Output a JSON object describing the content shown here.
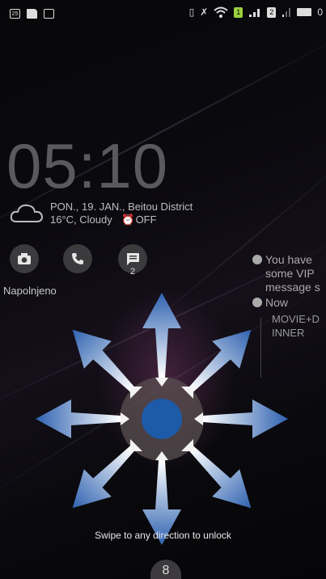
{
  "status_bar": {
    "left_icons": [
      "calendar-icon",
      "sim-card-icon",
      "image-icon"
    ],
    "right_icons": [
      "vibrate-icon",
      "no-alarm-icon",
      "wifi-icon",
      "sim1-signal-icon",
      "sim2-signal-icon",
      "battery-icon"
    ],
    "sim1_label": "1",
    "sim2_label": "2",
    "calendar_day": "25",
    "battery_text": "0"
  },
  "lock": {
    "time": "05:10",
    "date_location": "PON., 19. JAN., Beitou District",
    "temperature_condition": "16°C, Cloudy",
    "alarm_status": "OFF",
    "charging_status": "Napolnjeno",
    "unlock_hint": "Swipe to any direction to unlock",
    "bottom_handle": "8"
  },
  "shortcuts": [
    {
      "name": "camera-shortcut",
      "icon": "camera-icon"
    },
    {
      "name": "phone-shortcut",
      "icon": "phone-icon"
    },
    {
      "name": "messages-shortcut",
      "icon": "message-icon",
      "badge": "2"
    }
  ],
  "notifications": {
    "vip_text": "You have some VIP message s",
    "time_label": "Now",
    "event_title": "MOVIE+D INNER"
  },
  "colors": {
    "arrow_blue": "#2f62b0",
    "unlock_dot": "#1d5aa8",
    "sim_green": "#9bd13c"
  }
}
